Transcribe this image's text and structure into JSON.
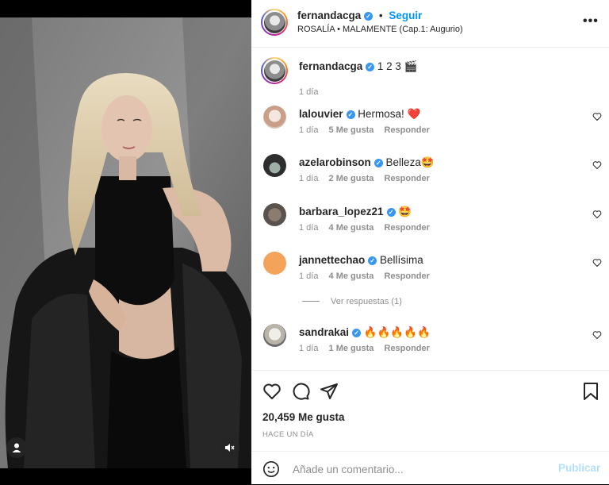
{
  "post": {
    "username": "fernandacga",
    "follow_label": "Seguir",
    "audio": "ROSALÍA • MALAMENTE (Cap.1: Augurio)",
    "more_label": "•••"
  },
  "caption": {
    "username": "fernandacga",
    "text": "1 2 3 🎬",
    "time": "1 día"
  },
  "comments": [
    {
      "username": "lalouvier",
      "text": "Hermosa! ❤️",
      "time": "1 día",
      "likes": "5 Me gusta",
      "reply": "Responder"
    },
    {
      "username": "azelarobinson",
      "text": "Belleza🤩",
      "time": "1 día",
      "likes": "2 Me gusta",
      "reply": "Responder"
    },
    {
      "username": "barbara_lopez21",
      "text": "🤩",
      "time": "1 día",
      "likes": "4 Me gusta",
      "reply": "Responder"
    },
    {
      "username": "jannettechao",
      "text": "Bellísima",
      "time": "1 día",
      "likes": "4 Me gusta",
      "reply": "Responder"
    },
    {
      "username": "sandrakai",
      "text": "🔥🔥🔥🔥🔥",
      "time": "1 día",
      "likes": "1 Me gusta",
      "reply": "Responder"
    }
  ],
  "view_replies": "Ver respuestas (1)",
  "likes_count": "20,459 Me gusta",
  "post_date": "HACE UN DÍA",
  "add_comment": {
    "placeholder": "Añade un comentario...",
    "publish_label": "Publicar"
  },
  "colors": {
    "accent": "#0095f6",
    "verified": "#3897f0",
    "muted": "#8e8e8e",
    "heart_red": "#ed4956",
    "publish_disabled": "#b2dffc"
  },
  "icons": [
    "user-tag-icon",
    "mute-icon",
    "verified-icon",
    "more-icon",
    "heart-icon",
    "comment-icon",
    "share-icon",
    "bookmark-icon",
    "emoji-icon"
  ]
}
